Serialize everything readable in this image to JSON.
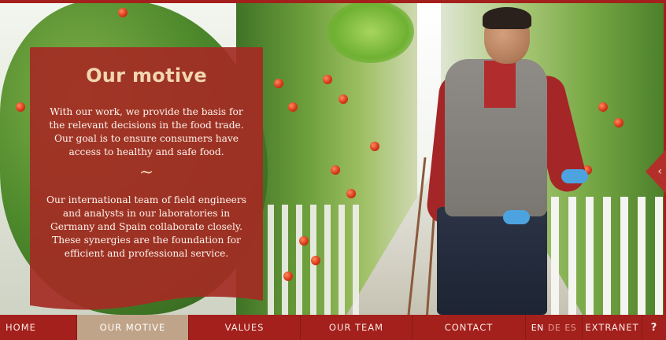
{
  "card": {
    "title": "Our motive",
    "paragraph1": "With our work, we provide the basis for the relevant decisions in the food trade. Our goal is to ensure consumers have access to healthy and safe food.",
    "separator": "~",
    "paragraph2": "Our international team of field engineers and analysts in our laboratories in Germany and Spain collaborate closely. These synergies are the foundation for efficient and professional service."
  },
  "nav": {
    "home": "HOME",
    "our_motive": "OUR MOTIVE",
    "values": "VALUES",
    "our_team": "OUR TEAM",
    "contact": "CONTACT",
    "languages": [
      "EN",
      "DE",
      "ES"
    ],
    "current_language": "EN",
    "extranet": "EXTRANET",
    "help": "?"
  },
  "side_arrow": {
    "icon": "chevron-left-icon",
    "glyph": "‹"
  },
  "colors": {
    "brand_red": "#a3201c",
    "card_red": "#a42b24",
    "active_tab": "#c0a489",
    "title_gold": "#f1d6b2"
  }
}
